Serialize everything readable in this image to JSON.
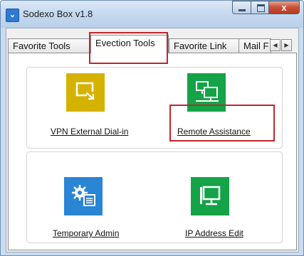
{
  "window": {
    "title": "Sodexo Box v1.8",
    "close_glyph": "x"
  },
  "tabs": [
    {
      "label": "Favorite Tools",
      "active": false
    },
    {
      "label": "Evection Tools",
      "active": true
    },
    {
      "label": "Favorite Link",
      "active": false
    },
    {
      "label": "Mail F",
      "active": false
    }
  ],
  "tab_scroll": {
    "left_glyph": "◀",
    "right_glyph": "▶"
  },
  "tools": [
    {
      "label": "VPN External Dial-in",
      "icon": "vpn-dialin-icon",
      "color": "#d6b200"
    },
    {
      "label": "Remote Assistance",
      "icon": "remote-assistance-icon",
      "color": "#14a347"
    },
    {
      "label": "Temporary Admin",
      "icon": "admin-settings-icon",
      "color": "#2a85d5"
    },
    {
      "label": "IP Address Edit",
      "icon": "ip-monitor-icon",
      "color": "#14a347"
    }
  ],
  "colors": {
    "highlight": "#c0262c"
  }
}
